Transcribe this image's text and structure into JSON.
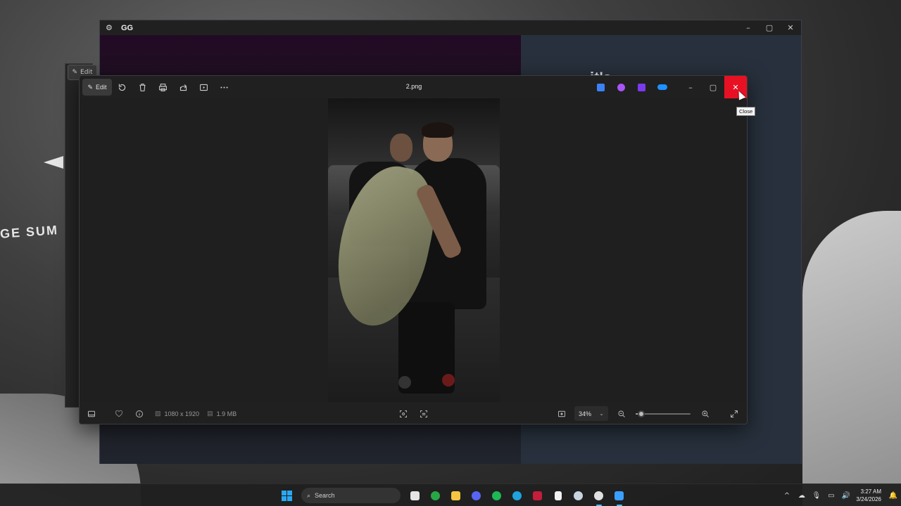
{
  "wallpaper": {
    "text": "GE  SUM"
  },
  "gg_window": {
    "title": "GG",
    "heading": "it's"
  },
  "ghost_window": {
    "edit_label": "Edit"
  },
  "photos": {
    "filename": "2.png",
    "toolbar": {
      "edit_label": "Edit",
      "icons": [
        "rotate-icon",
        "delete-icon",
        "print-icon",
        "share-icon",
        "slideshow-icon",
        "more-icon"
      ]
    },
    "app_icons": [
      {
        "name": "photos-app-icon",
        "color": "#3b82f6"
      },
      {
        "name": "clipchamp-icon",
        "color": "#a855f7"
      },
      {
        "name": "video-editor-icon",
        "color": "#7c3aed"
      },
      {
        "name": "onedrive-icon",
        "color": "#1e90ff"
      }
    ],
    "window_buttons": {
      "minimize": "–",
      "maximize": "▢",
      "close": "✕"
    },
    "tooltip": "Close",
    "status": {
      "dimensions": "1080 x 1920",
      "file_size": "1.9 MB",
      "zoom_value": "34%",
      "zoom_fraction": 0.04
    }
  },
  "taskbar": {
    "search_placeholder": "Search",
    "apps": [
      {
        "name": "task-view-icon",
        "color": "#e5e5e5"
      },
      {
        "name": "xbox-icon",
        "color": "#28a745"
      },
      {
        "name": "file-explorer-icon",
        "color": "#f5c542"
      },
      {
        "name": "discord-icon",
        "color": "#5865f2"
      },
      {
        "name": "spotify-icon",
        "color": "#1db954"
      },
      {
        "name": "edge-icon",
        "color": "#1fa3e0"
      },
      {
        "name": "adobe-icon",
        "color": "#c41e3a"
      },
      {
        "name": "notepad-icon",
        "color": "#f2f2f2"
      },
      {
        "name": "steam-icon",
        "color": "#c7d5e0"
      },
      {
        "name": "settings-icon",
        "color": "#e0e0e0"
      },
      {
        "name": "photos-icon",
        "color": "#3aa0ff"
      }
    ],
    "time": "3:27 AM",
    "date": "3/24/2026"
  }
}
